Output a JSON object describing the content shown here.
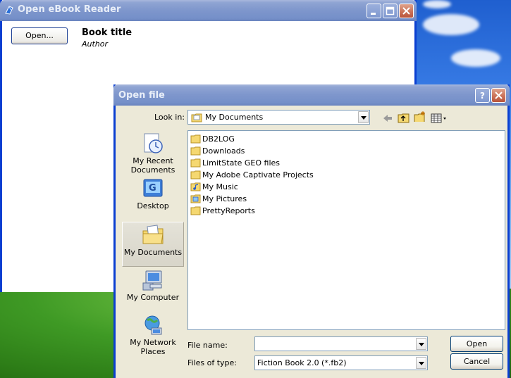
{
  "main_window": {
    "title": "Open eBook Reader",
    "open_button_label": "Open...",
    "book_title": "Book title",
    "book_author": "Author"
  },
  "dialog": {
    "title": "Open file",
    "look_in_label": "Look in:",
    "look_in_value": "My Documents",
    "places": [
      {
        "label": "My Recent Documents",
        "icon": "recent-documents-icon"
      },
      {
        "label": "Desktop",
        "icon": "desktop-icon"
      },
      {
        "label": "My Documents",
        "icon": "my-documents-icon",
        "selected": true
      },
      {
        "label": "My Computer",
        "icon": "my-computer-icon"
      },
      {
        "label": "My Network Places",
        "icon": "network-places-icon"
      }
    ],
    "files": [
      {
        "name": "DB2LOG",
        "icon": "folder-icon"
      },
      {
        "name": "Downloads",
        "icon": "folder-icon"
      },
      {
        "name": "LimitState GEO files",
        "icon": "folder-icon"
      },
      {
        "name": "My Adobe Captivate Projects",
        "icon": "folder-icon"
      },
      {
        "name": "My Music",
        "icon": "music-folder-icon"
      },
      {
        "name": "My Pictures",
        "icon": "pictures-folder-icon"
      },
      {
        "name": "PrettyReports",
        "icon": "folder-icon"
      }
    ],
    "file_name_label": "File name:",
    "file_name_value": "",
    "files_of_type_label": "Files of type:",
    "files_of_type_value": "Fiction Book 2.0 (*.fb2)",
    "open_button": "Open",
    "cancel_button": "Cancel"
  },
  "colors": {
    "title_bar": "#7e96cc",
    "window_border": "#0a3fd1",
    "dialog_face": "#ece9d8"
  }
}
